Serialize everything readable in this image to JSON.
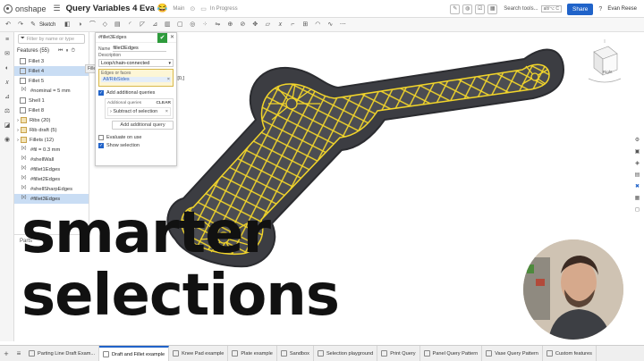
{
  "app": {
    "logo_text": "onshape",
    "document_title": "Query Variables 4 Eva",
    "title_emoji": "😂",
    "workspace": "Main",
    "status": "In Progress",
    "search_label": "Search tools...",
    "search_shortcut": "alt/⌥ C",
    "share_label": "Share",
    "help_label": "?",
    "user_name": "Evan Reese"
  },
  "toolbar": {
    "sketch_label": "Sketch"
  },
  "feature_list": {
    "filter_placeholder": "Filter by name or type",
    "header": "Features (55)",
    "hover_tip": "Fillet 4",
    "items": [
      {
        "label": "Fillet 3",
        "kind": "feature"
      },
      {
        "label": "Fillet 4",
        "kind": "feature",
        "selected": true
      },
      {
        "label": "Fillet 5",
        "kind": "feature"
      },
      {
        "label": "#nominal = 5 mm",
        "kind": "variable"
      },
      {
        "label": "Shell 1",
        "kind": "feature"
      },
      {
        "label": "Fillet 8",
        "kind": "feature"
      },
      {
        "label": "Ribs (20)",
        "kind": "group"
      },
      {
        "label": "Rib draft (5)",
        "kind": "group"
      },
      {
        "label": "Fillets (12)",
        "kind": "group"
      },
      {
        "label": "#fil = 0.3 mm",
        "kind": "variable"
      },
      {
        "label": "#shellWall",
        "kind": "variable"
      },
      {
        "label": "#fillet1Edges",
        "kind": "variable"
      },
      {
        "label": "#fillet2Edges",
        "kind": "variable"
      },
      {
        "label": "#shellSharpEdges",
        "kind": "variable"
      },
      {
        "label": "#fillet3Edges",
        "kind": "variable",
        "highlighted": true
      }
    ],
    "parts_label": "Parts"
  },
  "dialog": {
    "title": "#fillet3Edges",
    "name_label": "Name",
    "name_value": "fillet3Edges",
    "description_label": "Description",
    "type_value": "Loop/chain-connected",
    "edges_label": "Edges or faces",
    "edges_value": "All/RibSides",
    "suffix": "[0,]",
    "add_queries_label": "Add additional queries",
    "additional_queries_label": "Additional queries",
    "clear_label": "CLEAR",
    "query_item": "Subtract of selection",
    "add_query_button": "Add additional query",
    "evaluate_label": "Evaluate on use",
    "show_selection_label": "Show selection"
  },
  "viewcube": {
    "face_label": "Right"
  },
  "overlay": {
    "line1": "smarter",
    "line2": "selections"
  },
  "tabs": [
    {
      "label": "Parting Line Draft Exam...",
      "active": false
    },
    {
      "label": "Draft and Fillet example",
      "active": true
    },
    {
      "label": "Knee Pad example",
      "active": false
    },
    {
      "label": "Plate example",
      "active": false
    },
    {
      "label": "Sandbox",
      "active": false
    },
    {
      "label": "Selection playground",
      "active": false
    },
    {
      "label": "Print Query",
      "active": false
    },
    {
      "label": "Panel Query Pattern",
      "active": false
    },
    {
      "label": "Vase Query Pattern",
      "active": false
    },
    {
      "label": "Custom features",
      "active": false
    }
  ],
  "colors": {
    "accent": "#2063c9",
    "confirm": "#2e9b3c",
    "highlight_edges": "#f2d52a",
    "part_body": "#3c3d42"
  }
}
